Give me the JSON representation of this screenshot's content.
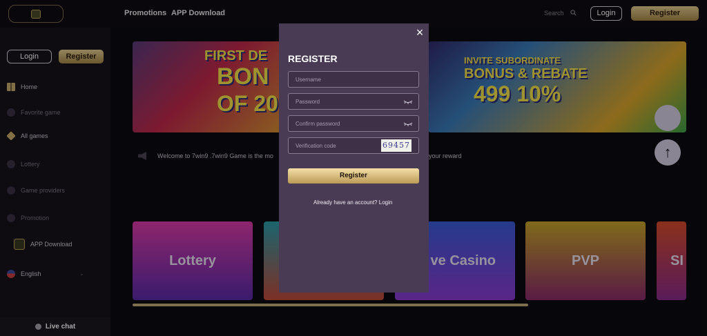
{
  "header": {
    "nav": [
      "Promotions",
      "APP Download"
    ],
    "search_label": "Search",
    "login_label": "Login",
    "register_label": "Register"
  },
  "sidebar": {
    "login_label": "Login",
    "register_label": "Register",
    "items": [
      {
        "label": "Home",
        "icon": "home-icon"
      },
      {
        "label": "Favorite game",
        "icon": "heart-icon"
      },
      {
        "label": "All games",
        "icon": "grid-icon"
      },
      {
        "label": "Lottery",
        "icon": "lottery-icon"
      },
      {
        "label": "Game providers",
        "icon": "provider-icon"
      },
      {
        "label": "Promotion",
        "icon": "gift-icon"
      },
      {
        "label": "APP Download",
        "icon": "app-icon"
      },
      {
        "label": "English",
        "icon": "flag-icon"
      }
    ],
    "live_chat_label": "Live chat"
  },
  "banners": [
    {
      "line1": "FIRST DE",
      "line2": "BON",
      "line3": "OF 20"
    },
    {
      "line1": "INVITE SUBORDINATE",
      "line2": "BONUS & REBATE",
      "line3": "499 10%"
    }
  ],
  "marquee": {
    "text_start": "Welcome to 7win9 .7win9 Game is the mo",
    "text_end": "your reward"
  },
  "categories": [
    "Lottery",
    "",
    "ve Casino",
    "PVP",
    "SI"
  ],
  "modal": {
    "title": "REGISTER",
    "username_placeholder": "Username",
    "password_placeholder": "Password",
    "confirm_placeholder": "Confirm password",
    "verification_placeholder": "Verification code",
    "captcha": "69457",
    "register_button": "Register",
    "already_text": "Already have an account?",
    "login_link": "Login",
    "close_symbol": "×"
  },
  "colors": {
    "accent_gold": "#c9ab6a",
    "modal_bg": "#4a3b55",
    "page_bg": "#100d13"
  }
}
